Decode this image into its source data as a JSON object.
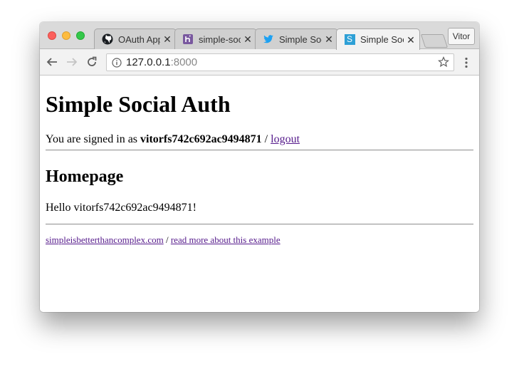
{
  "browser": {
    "tabs": [
      {
        "title": "OAuth App",
        "icon": "github-icon",
        "active": false
      },
      {
        "title": "simple-soc",
        "icon": "heroku-icon",
        "active": false
      },
      {
        "title": "Simple Soc",
        "icon": "twitter-icon",
        "active": false
      },
      {
        "title": "Simple Soc",
        "icon": "s-favicon-icon",
        "active": true
      }
    ],
    "tab_close_glyph": "✕",
    "profile_name": "Vitor",
    "address": {
      "host": "127.0.0.1",
      "port": ":8000"
    },
    "s_favicon_letter": "S"
  },
  "page": {
    "title": "Simple Social Auth",
    "signed_in_prefix": "You are signed in as",
    "username": "vitorfs742c692ac9494871",
    "separator": "/",
    "logout_label": "logout",
    "heading": "Homepage",
    "greeting": "Hello vitorfs742c692ac9494871!",
    "footer": {
      "site_link": "simpleisbetterthancomplex.com",
      "separator": "/",
      "more_link": "read more about this example"
    }
  },
  "colors": {
    "visited_link": "#551a8b",
    "twitter_blue": "#1da1f2",
    "heroku_purple": "#79589f",
    "s_favicon_bg": "#2ea0d6"
  }
}
